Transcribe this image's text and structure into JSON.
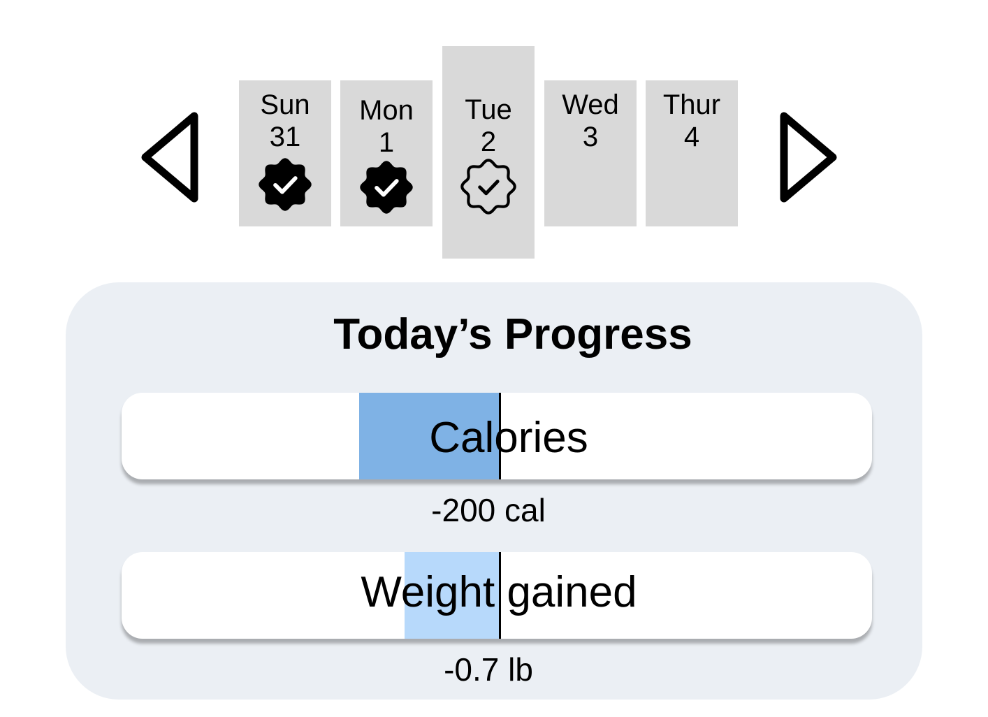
{
  "week_nav": {
    "prev_icon": "triangle-left-outline",
    "next_icon": "triangle-right-outline",
    "days": [
      {
        "name": "Sun",
        "date": "31",
        "status": "completed",
        "badge_icon": "verified-badge-filled"
      },
      {
        "name": "Mon",
        "date": "1",
        "status": "completed",
        "badge_icon": "verified-badge-filled"
      },
      {
        "name": "Tue",
        "date": "2",
        "status": "selected-today",
        "badge_icon": "verified-badge-outline"
      },
      {
        "name": "Wed",
        "date": "3",
        "status": "none"
      },
      {
        "name": "Thur",
        "date": "4",
        "status": "none"
      }
    ]
  },
  "progress": {
    "title": "Today’s Progress",
    "bars": [
      {
        "label": "Calories",
        "value_text": "-200 cal",
        "value": -200,
        "scale_min": -540,
        "scale_max": 534,
        "fill_color": "#7fb2e5"
      },
      {
        "label": "Weight gained",
        "value_text": "-0.7 lb",
        "value": -0.7,
        "scale_min": -2.8,
        "scale_max": 2.8,
        "fill_color": "#b7d9fb"
      }
    ]
  },
  "colors": {
    "day_card_bg": "#d9d9d9",
    "panel_bg": "#ebeff4",
    "bar_bg": "#ffffff"
  }
}
